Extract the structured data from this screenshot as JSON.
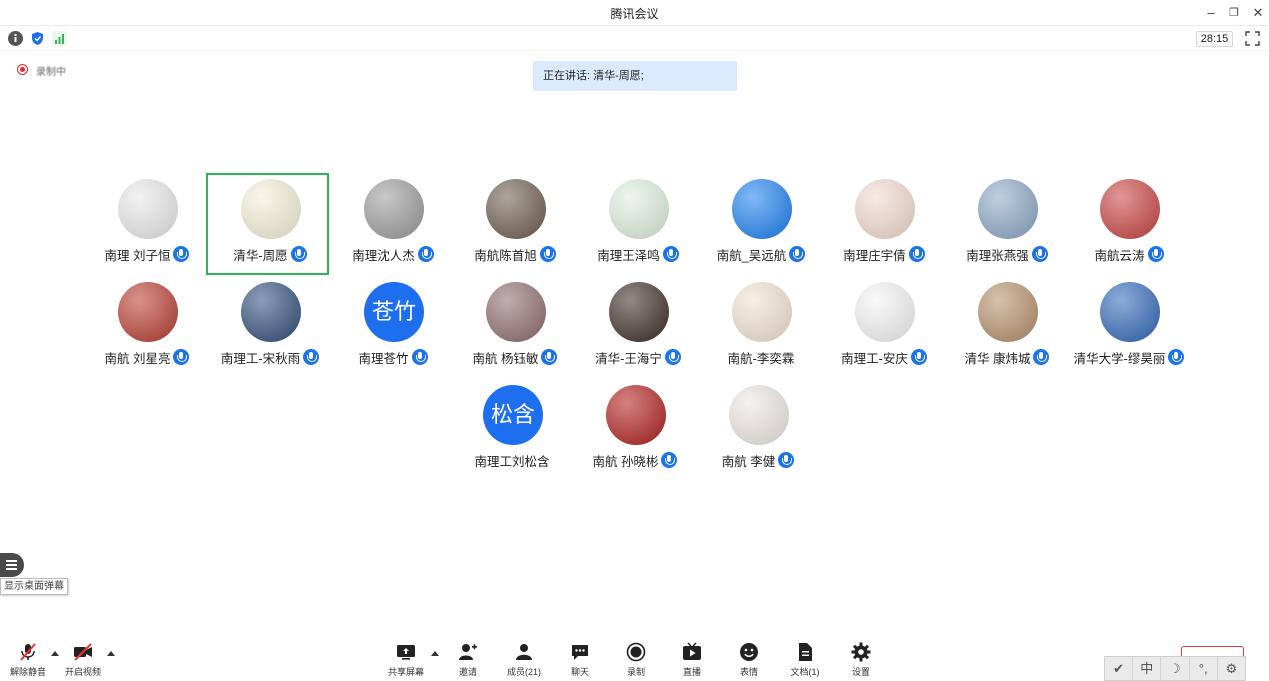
{
  "window": {
    "title": "腾讯会议"
  },
  "info": {
    "timer": "28:15"
  },
  "recording": {
    "label": "录制中"
  },
  "speaking": {
    "text": "正在讲话: 清华-周愿;"
  },
  "participants": [
    {
      "name": "南理 刘子恒",
      "avatar_text": "",
      "avatar_color": "#e8e8e8",
      "mic": true
    },
    {
      "name": "清华-周愿",
      "avatar_text": "",
      "avatar_color": "#f5f0d8",
      "mic": true
    },
    {
      "name": "南理沈人杰",
      "avatar_text": "",
      "avatar_color": "#9a9a9a",
      "mic": true
    },
    {
      "name": "南航陈首旭",
      "avatar_text": "",
      "avatar_color": "#6b5a4b",
      "mic": true
    },
    {
      "name": "南理王泽鸣",
      "avatar_text": "",
      "avatar_color": "#dfeede",
      "mic": true
    },
    {
      "name": "南航_吴远航",
      "avatar_text": "",
      "avatar_color": "#1a7ff0",
      "mic": true
    },
    {
      "name": "南理庄宇倩",
      "avatar_text": "",
      "avatar_color": "#f3d9cf",
      "mic": true
    },
    {
      "name": "南理张燕强",
      "avatar_text": "",
      "avatar_color": "#8aa7c4",
      "mic": true
    },
    {
      "name": "南航云涛",
      "avatar_text": "",
      "avatar_color": "#c84040",
      "mic": true
    },
    {
      "name": "南航 刘星亮",
      "avatar_text": "",
      "avatar_color": "#b83a2e",
      "mic": true
    },
    {
      "name": "南理工-宋秋雨",
      "avatar_text": "",
      "avatar_color": "#2d4c7a",
      "mic": true
    },
    {
      "name": "南理苍竹",
      "avatar_text": "苍竹",
      "avatar_color": "#1e6ff0",
      "mic": true
    },
    {
      "name": "南航 杨钰敏",
      "avatar_text": "",
      "avatar_color": "#8d6a6a",
      "mic": true
    },
    {
      "name": "清华-王海宁",
      "avatar_text": "",
      "avatar_color": "#3a2a22",
      "mic": true
    },
    {
      "name": "南航-李奕霖",
      "avatar_text": "",
      "avatar_color": "#f1e2d0",
      "mic": false
    },
    {
      "name": "南理工-安庆",
      "avatar_text": "",
      "avatar_color": "#f4f4f4",
      "mic": true
    },
    {
      "name": "清华 康炜城",
      "avatar_text": "",
      "avatar_color": "#b48e68",
      "mic": true
    },
    {
      "name": "清华大学-缪昊丽",
      "avatar_text": "",
      "avatar_color": "#2f66b8",
      "mic": true
    },
    {
      "name": "南理工刘松含",
      "avatar_text": "松含",
      "avatar_color": "#1e6ff0",
      "mic": false
    },
    {
      "name": "南航 孙晓彬",
      "avatar_text": "",
      "avatar_color": "#b01c1c",
      "mic": true
    },
    {
      "name": "南航 李健",
      "avatar_text": "",
      "avatar_color": "#ece8e2",
      "mic": true
    }
  ],
  "sidebar": {
    "tooltip": "显示桌面弹幕"
  },
  "toolbar": {
    "mute": "解除静音",
    "video": "开启视频",
    "share": "共享屏幕",
    "invite": "邀请",
    "members": "成员(21)",
    "chat": "聊天",
    "record": "录制",
    "live": "直播",
    "emoji": "表情",
    "docs": "文档(1)",
    "settings": "设置"
  },
  "ime": {
    "items": [
      "✔",
      "中",
      "☽",
      "°,",
      "⚙"
    ]
  }
}
